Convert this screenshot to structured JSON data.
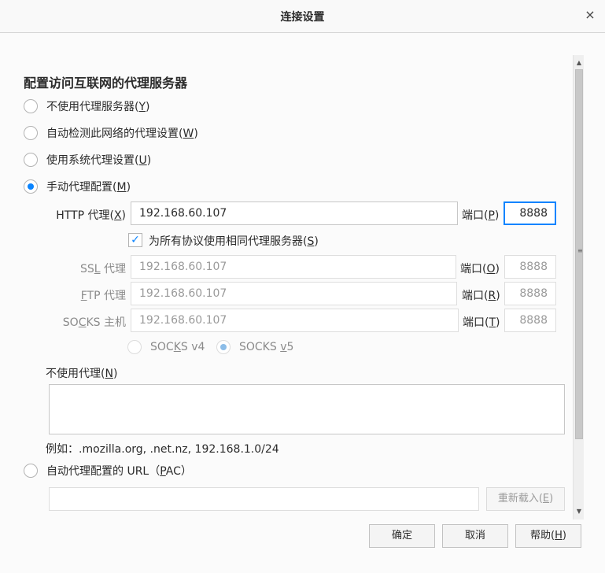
{
  "window": {
    "title": "连接设置",
    "close_icon": "×"
  },
  "section_heading": "配置访问互联网的代理服务器",
  "options": {
    "no_proxy": {
      "text": "不使用代理服务器",
      "key": "Y"
    },
    "auto_detect": {
      "text": "自动检测此网络的代理设置",
      "key": "W"
    },
    "system": {
      "text": "使用系统代理设置",
      "key": "U"
    },
    "manual": {
      "text": "手动代理配置",
      "key": "M"
    },
    "auto_url": {
      "pre": "自动代理配置的 URL（",
      "key": "P",
      "post": "AC）"
    }
  },
  "selected_option": "manual",
  "http": {
    "label_pre": "HTTP 代理(",
    "key": "X",
    "label_post": ")",
    "value": "192.168.60.107",
    "port_pre": "端口(",
    "port_key": "P",
    "port_post": ")",
    "port": "8888"
  },
  "same_proxy": {
    "pre": "为所有协议使用相同代理服务器(",
    "key": "S",
    "post": ")",
    "checked": true
  },
  "ssl": {
    "pre": "SS",
    "key": "L",
    "post": " 代理",
    "value": "192.168.60.107",
    "port_pre": "端口(",
    "port_key": "O",
    "port_post": ")",
    "port": "8888"
  },
  "ftp": {
    "key": "F",
    "post": "TP 代理",
    "value": "192.168.60.107",
    "port_pre": "端口(",
    "port_key": "R",
    "port_post": ")",
    "port": "8888"
  },
  "socks": {
    "pre": "SO",
    "key": "C",
    "post": "KS 主机",
    "value": "192.168.60.107",
    "port_pre": "端口(",
    "port_key": "T",
    "port_post": ")",
    "port": "8888"
  },
  "socks_v4": {
    "pre": "SOC",
    "key": "K",
    "post": "S v4"
  },
  "socks_v5": {
    "pre": "SOCKS ",
    "key": "v",
    "post": "5"
  },
  "no_proxy_for": {
    "pre": "不使用代理(",
    "key": "N",
    "post": ")",
    "value": ""
  },
  "example": "例如：.mozilla.org, .net.nz, 192.168.1.0/24",
  "auto_url_value": "",
  "reload": {
    "pre": "重新载入(",
    "key": "E",
    "post": ")"
  },
  "buttons": {
    "ok": "确定",
    "cancel": "取消",
    "help_pre": "帮助(",
    "help_key": "H",
    "help_post": ")"
  },
  "colors": {
    "accent": "#0a84ff",
    "background": "#fbfbfb",
    "border": "#c7c7c7"
  }
}
